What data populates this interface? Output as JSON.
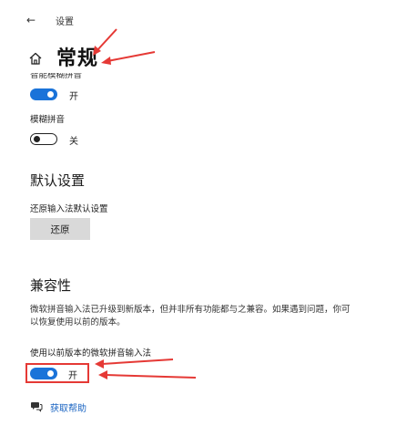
{
  "header": {
    "back_glyph": "←",
    "window_title": "设置"
  },
  "page": {
    "title": "常规",
    "home_icon": "home-icon"
  },
  "settings": {
    "partial_label": "智能模糊拼音",
    "first_toggle": {
      "state": "on",
      "state_label": "开"
    },
    "fuzzy_pinyin": {
      "label": "模糊拼音",
      "state": "off",
      "state_label": "关"
    }
  },
  "default_section": {
    "heading": "默认设置",
    "reset_label": "还原输入法默认设置",
    "reset_button": "还原"
  },
  "compat_section": {
    "heading": "兼容性",
    "description": "微软拼音输入法已升级到新版本，但并非所有功能都与之兼容。如果遇到问题，你可以恢复使用以前的版本。",
    "legacy_toggle": {
      "label": "使用以前版本的微软拼音输入法",
      "state": "on",
      "state_label": "开"
    }
  },
  "help": {
    "link_text": "获取帮助",
    "icon": "help-chat-icon"
  },
  "colors": {
    "accent": "#1a73d9",
    "annotation": "#e53935",
    "link": "#1a64c2",
    "button_bg": "#d9d9d9"
  }
}
